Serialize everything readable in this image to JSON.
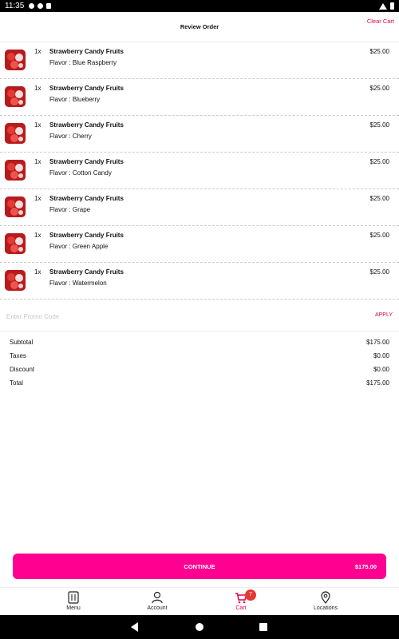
{
  "status_bar": {
    "time": "11:35"
  },
  "header": {
    "title": "Review Order",
    "clear_cart": "Clear Cart"
  },
  "items": [
    {
      "qty": "1x",
      "name": "Strawberry Candy Fruits",
      "flavor": "Flavor : Blue Raspberry",
      "price": "$25.00"
    },
    {
      "qty": "1x",
      "name": "Strawberry Candy Fruits",
      "flavor": "Flavor : Blueberry",
      "price": "$25.00"
    },
    {
      "qty": "1x",
      "name": "Strawberry Candy Fruits",
      "flavor": "Flavor : Cherry",
      "price": "$25.00"
    },
    {
      "qty": "1x",
      "name": "Strawberry Candy Fruits",
      "flavor": "Flavor : Cotton Candy",
      "price": "$25.00"
    },
    {
      "qty": "1x",
      "name": "Strawberry Candy Fruits",
      "flavor": "Flavor : Grape",
      "price": "$25.00"
    },
    {
      "qty": "1x",
      "name": "Strawberry Candy Fruits",
      "flavor": "Flavor : Green Apple",
      "price": "$25.00"
    },
    {
      "qty": "1x",
      "name": "Strawberry Candy Fruits",
      "flavor": "Flavor : Watermelon",
      "price": "$25.00"
    }
  ],
  "promo": {
    "placeholder": "Enter Promo Code",
    "apply": "APPLY"
  },
  "summary": [
    {
      "label": "Subtotal",
      "value": "$175.00"
    },
    {
      "label": "Taxes",
      "value": "$0.00"
    },
    {
      "label": "Discount",
      "value": "$0.00"
    },
    {
      "label": "Total",
      "value": "$175.00"
    }
  ],
  "continue": {
    "label": "CONTINUE",
    "amount": "$175.00"
  },
  "tabs": {
    "menu": "Menu",
    "account": "Account",
    "cart": "Cart",
    "cart_badge": "7",
    "locations": "Locations"
  },
  "colors": {
    "accent": "#ff0090",
    "accent_text": "#e5004f",
    "badge": "#e53935"
  },
  "icons": [
    "menu-icon",
    "account-icon",
    "cart-icon",
    "location-pin-icon",
    "back-icon",
    "home-icon",
    "recents-icon"
  ]
}
